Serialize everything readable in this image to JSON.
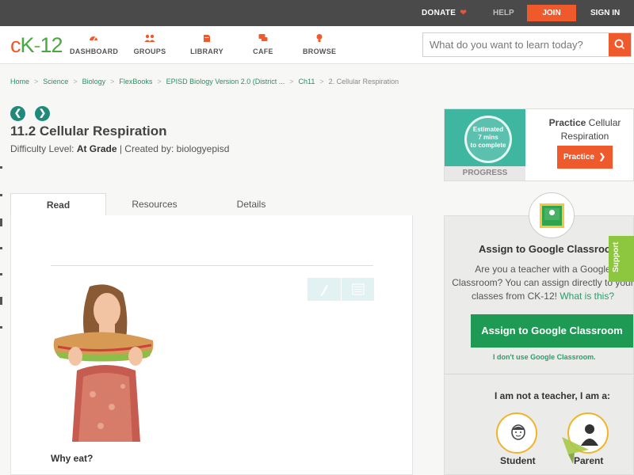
{
  "topbar": {
    "donate": "DONATE",
    "help": "HELP",
    "join": "JOIN",
    "signin": "SIGN IN"
  },
  "logo": {
    "c": "c",
    "k": "K",
    "dash": "-",
    "num": "12"
  },
  "nav": {
    "items": [
      {
        "label": "DASHBOARD",
        "icon": "dashboard-icon"
      },
      {
        "label": "GROUPS",
        "icon": "groups-icon"
      },
      {
        "label": "LIBRARY",
        "icon": "library-icon"
      },
      {
        "label": "CAFE",
        "icon": "cafe-icon"
      },
      {
        "label": "BROWSE",
        "icon": "browse-icon"
      }
    ],
    "search_placeholder": "What do you want to learn today?"
  },
  "breadcrumb": [
    "Home",
    "Science",
    "Biology",
    "FlexBooks",
    "EPISD Biology Version 2.0 (District ...",
    "Ch11",
    "2. Cellular Respiration"
  ],
  "title": "11.2 Cellular Respiration",
  "subtitle": {
    "difficulty_label": "Difficulty Level: ",
    "difficulty": "At Grade",
    "created": " | Created by: biologyepisd"
  },
  "tabs": [
    "Read",
    "Resources",
    "Details"
  ],
  "content": {
    "heading": "Why eat?"
  },
  "practice": {
    "estimated": "Estimated",
    "mins": "7 mins",
    "to_complete": "to complete",
    "progress": "PROGRESS",
    "title_bold": "Practice",
    "title_rest": " Cellular Respiration",
    "button": "Practice"
  },
  "assign": {
    "heading": "Assign to Google Classroom",
    "para_1": "Are you a teacher with a Google Classroom? You can assign directly to your classes from CK-12! ",
    "para_link": "What is this?",
    "button": "Assign to Google Classroom",
    "no_use": "I don't use Google Classroom.",
    "not_teacher": "I am not a teacher, I am a:",
    "roles": [
      "Student",
      "Parent"
    ]
  },
  "support": "Support",
  "colors": {
    "accent": "#ef5a2c",
    "green": "#1e9a55",
    "teal": "#1f8a7a",
    "link": "#2a8f66"
  }
}
